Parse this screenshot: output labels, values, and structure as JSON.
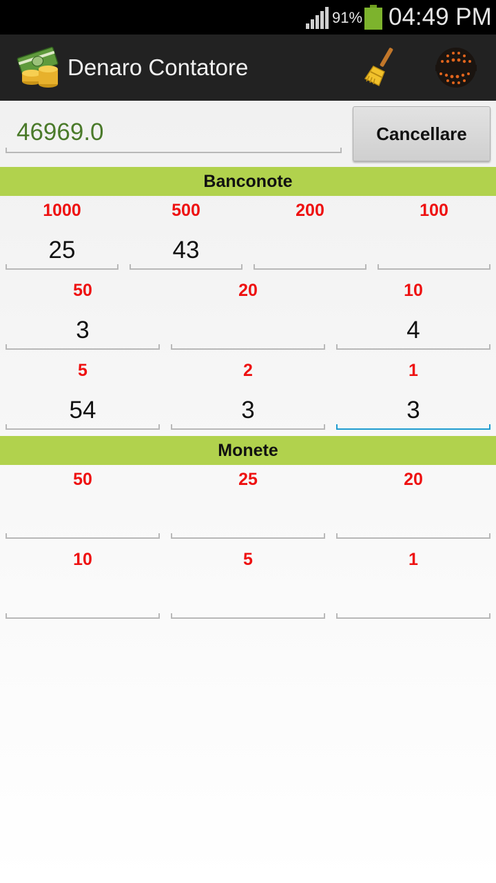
{
  "status_bar": {
    "battery_percent": "91%",
    "time": "04:49 PM",
    "signal_icon": "signal-bars-icon",
    "battery_icon": "battery-icon"
  },
  "action_bar": {
    "title": "Denaro Contatore",
    "logo_icon": "money-stack-icon",
    "clear_icon": "broom-icon",
    "brand_icon": "sparkle-globe-icon"
  },
  "total": {
    "value": "46969.0",
    "color": "#4a7a2a"
  },
  "clear_button": {
    "label": "Cancellare"
  },
  "banconote": {
    "header": "Banconote",
    "row1": [
      {
        "denom": "1000",
        "count": "25"
      },
      {
        "denom": "500",
        "count": "43"
      },
      {
        "denom": "200",
        "count": ""
      },
      {
        "denom": "100",
        "count": ""
      }
    ],
    "row2": [
      {
        "denom": "50",
        "count": "3"
      },
      {
        "denom": "20",
        "count": ""
      },
      {
        "denom": "10",
        "count": "4"
      }
    ],
    "row3": [
      {
        "denom": "5",
        "count": "54"
      },
      {
        "denom": "2",
        "count": "3"
      },
      {
        "denom": "1",
        "count": "3"
      }
    ]
  },
  "monete": {
    "header": "Monete",
    "row1": [
      {
        "denom": "50",
        "count": ""
      },
      {
        "denom": "25",
        "count": ""
      },
      {
        "denom": "20",
        "count": ""
      }
    ],
    "row2": [
      {
        "denom": "10",
        "count": ""
      },
      {
        "denom": "5",
        "count": ""
      },
      {
        "denom": "1",
        "count": ""
      }
    ]
  },
  "colors": {
    "header_bg": "#b1d24d",
    "denomination": "#ee1111",
    "focus_underline": "#1e9bd0",
    "action_bar_bg": "#222222"
  }
}
